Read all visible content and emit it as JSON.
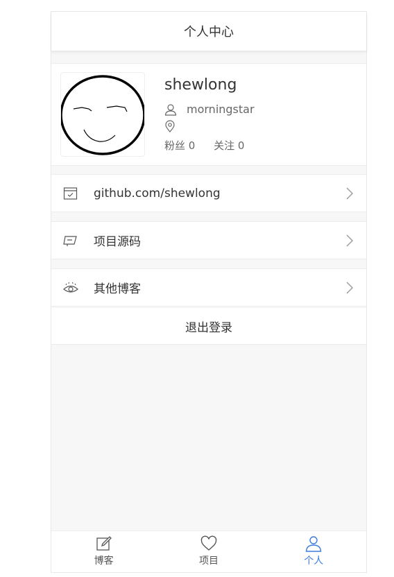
{
  "header": {
    "title": "个人中心"
  },
  "profile": {
    "username": "shewlong",
    "nickname": "morningstar",
    "location": "",
    "fans_label": "粉丝 0",
    "follow_label": "关注 0"
  },
  "menu": [
    {
      "label": "github.com/shewlong",
      "icon": "calendar-icon"
    },
    {
      "label": "项目源码",
      "icon": "book-icon"
    },
    {
      "label": "其他博客",
      "icon": "eye-icon"
    }
  ],
  "logout_label": "退出登录",
  "tabs": [
    {
      "label": "博客",
      "icon": "edit-icon",
      "active": false
    },
    {
      "label": "项目",
      "icon": "heart-icon",
      "active": false
    },
    {
      "label": "个人",
      "icon": "user-icon",
      "active": true
    }
  ],
  "colors": {
    "accent": "#3a7be0",
    "background": "#f7f7f7"
  }
}
